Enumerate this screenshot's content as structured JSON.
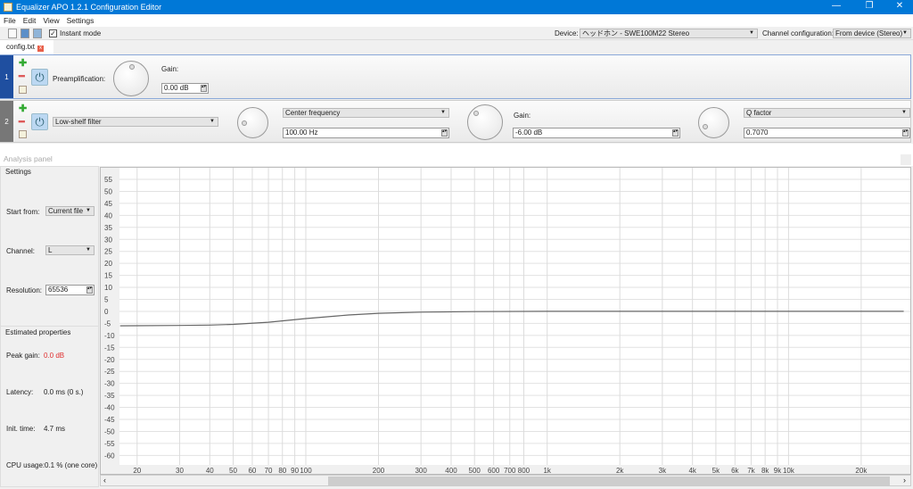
{
  "window": {
    "title": "Equalizer APO 1.2.1 Configuration Editor",
    "minimize": "—",
    "maximize": "❐",
    "close": "✕"
  },
  "menu": [
    "File",
    "Edit",
    "View",
    "Settings"
  ],
  "toolbar": {
    "instant_mode": "Instant mode",
    "instant_checked": true,
    "device_label": "Device:",
    "device_value": "ヘッドホン - SWE100M22 Stereo",
    "channel_label": "Channel configuration:",
    "channel_value": "From device (Stereo)"
  },
  "tab": {
    "label": "config.txt",
    "close": "x"
  },
  "filters": [
    {
      "index": "1",
      "type_label": "Preamplification:",
      "gain_label": "Gain:",
      "gain_value": "0.00 dB"
    },
    {
      "index": "2",
      "type_value": "Low-shelf filter",
      "freq_mode": "Center frequency",
      "freq_value": "100.00 Hz",
      "gain_label": "Gain:",
      "gain_value": "-6.00 dB",
      "q_mode": "Q factor",
      "q_value": "0.7070"
    }
  ],
  "analysis": {
    "title": "Analysis panel",
    "settings_title": "Settings",
    "start_from_label": "Start from:",
    "start_from_value": "Current file",
    "channel_label": "Channel:",
    "channel_value": "L",
    "resolution_label": "Resolution:",
    "resolution_value": "65536",
    "estimated_title": "Estimated properties",
    "peak_gain_label": "Peak gain:",
    "peak_gain_value": "0.0 dB",
    "latency_label": "Latency:",
    "latency_value": "0.0 ms (0 s.)",
    "init_label": "Init. time:",
    "init_value": "4.7 ms",
    "cpu_label": "CPU usage:",
    "cpu_value": "0.1 % (one core)"
  },
  "colors": {
    "titlebar": "#0078d7",
    "peak": "#e03030",
    "curve": "#666666"
  },
  "chart_data": {
    "type": "line",
    "title": "",
    "xlabel": "",
    "ylabel": "",
    "xscale": "log",
    "ylim": [
      -62.5,
      57.5
    ],
    "yticks": [
      55,
      50,
      45,
      40,
      35,
      30,
      25,
      20,
      15,
      10,
      5,
      0,
      -5,
      -10,
      -15,
      -20,
      -25,
      -30,
      -35,
      -40,
      -45,
      -50,
      -55,
      -60
    ],
    "xticks": [
      20,
      30,
      40,
      50,
      60,
      70,
      80,
      90,
      100,
      200,
      300,
      400,
      500,
      600,
      700,
      800,
      1000,
      2000,
      3000,
      4000,
      5000,
      6000,
      7000,
      8000,
      9000,
      10000,
      20000
    ],
    "xtick_labels": [
      "20",
      "30",
      "40",
      "50",
      "60",
      "70",
      "80",
      "90",
      "100",
      "200",
      "300",
      "400",
      "500",
      "600",
      "700",
      "800",
      "1k",
      "2k",
      "3k",
      "4k",
      "5k",
      "6k",
      "7k",
      "8k",
      "9k",
      "10k",
      "20k"
    ],
    "grid": true,
    "series": [
      {
        "name": "L",
        "x": [
          17,
          20,
          30,
          40,
          50,
          70,
          100,
          150,
          200,
          300,
          500,
          1000,
          30000
        ],
        "y": [
          -6,
          -5.95,
          -5.85,
          -5.7,
          -5.4,
          -4.5,
          -3,
          -1.5,
          -0.8,
          -0.3,
          -0.1,
          0,
          0
        ]
      }
    ]
  }
}
